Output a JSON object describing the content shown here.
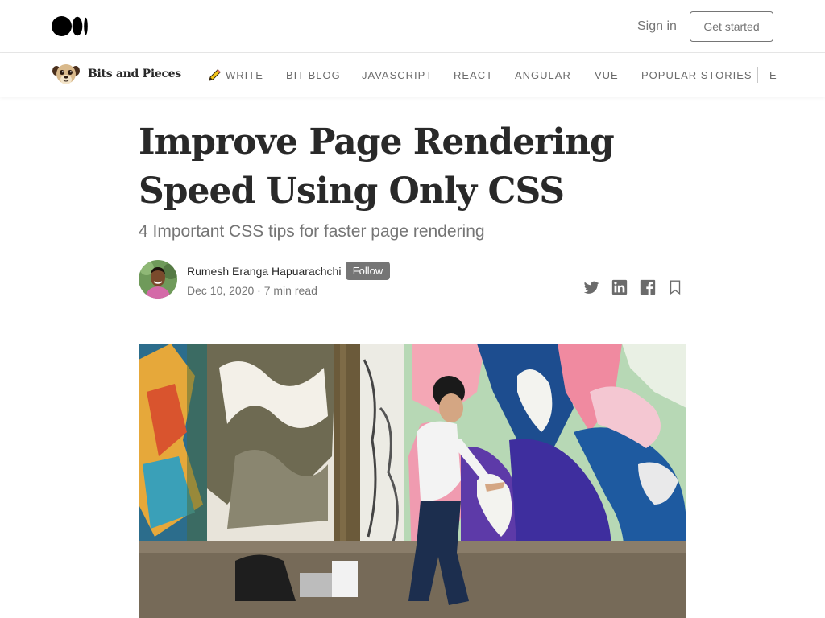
{
  "topbar": {
    "logo_icon": "medium-logo",
    "signin_label": "Sign in",
    "getstarted_label": "Get started"
  },
  "publication": {
    "logo_icon": "meerkat-logo",
    "name": "Bits and Pieces",
    "nav": [
      {
        "label": "WRITE",
        "icon": "pencil-icon"
      },
      {
        "label": "BIT BLOG"
      },
      {
        "label": "JAVASCRIPT"
      },
      {
        "label": "REACT"
      },
      {
        "label": "ANGULAR"
      },
      {
        "label": "VUE"
      },
      {
        "label": "POPULAR STORIES"
      }
    ],
    "nav_overflow_glyph": "E"
  },
  "article": {
    "title": "Improve Page Rendering Speed Using Only CSS",
    "subtitle": "4 Important CSS tips for faster page rendering",
    "author": "Rumesh Eranga Hapuarachchi",
    "follow_label": "Follow",
    "meta": "Dec 10, 2020 · 7 min read",
    "share_icons": [
      "twitter-icon",
      "linkedin-icon",
      "facebook-icon",
      "bookmark-icon"
    ]
  },
  "colors": {
    "text": "#292929",
    "muted": "#757575",
    "follow_bg": "#757575",
    "border": "#e6e6e6"
  }
}
